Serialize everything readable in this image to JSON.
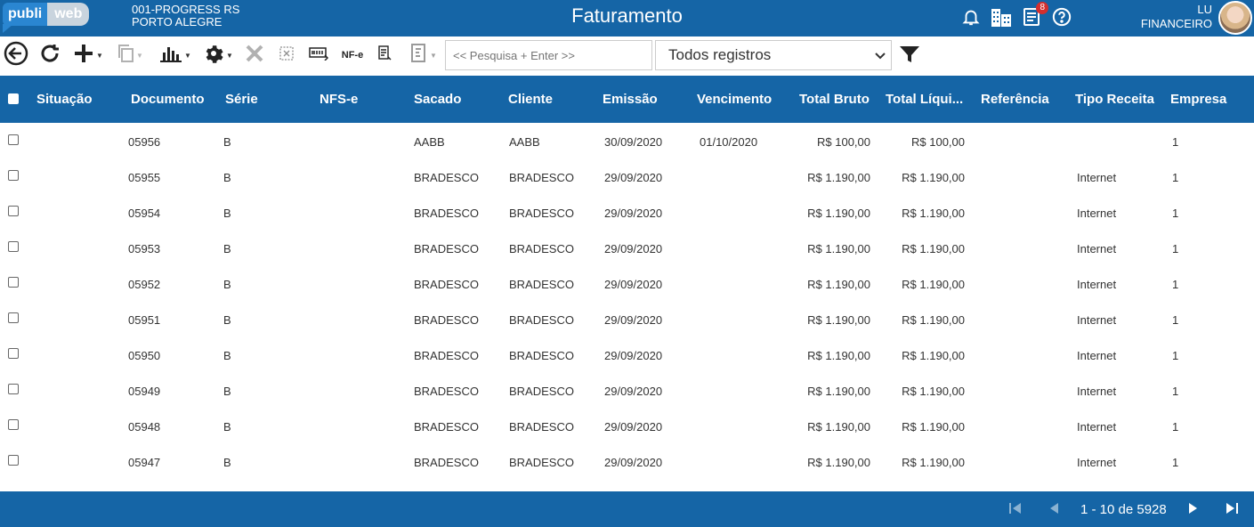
{
  "header": {
    "logo_left": "publi",
    "logo_right": "web",
    "company_line1": "001-PROGRESS RS",
    "company_line2": "PORTO ALEGRE",
    "title": "Faturamento",
    "notifications_badge": "8",
    "user_name": "LU",
    "user_role": "FINANCEIRO"
  },
  "toolbar": {
    "nfe_label": "NF-e",
    "search_placeholder": "<< Pesquisa + Enter >>",
    "filter_select_value": "Todos registros"
  },
  "table": {
    "columns": [
      "Situação",
      "Documento",
      "Série",
      "NFS-e",
      "Sacado",
      "Cliente",
      "Emissão",
      "Vencimento",
      "Total Bruto",
      "Total Líqui...",
      "Referência",
      "Tipo Receita",
      "Empresa"
    ],
    "rows": [
      {
        "situacao": "",
        "documento": "05956",
        "serie": "B",
        "nfse": "",
        "sacado": "AABB",
        "cliente": "AABB",
        "emissao": "30/09/2020",
        "vencimento": "01/10/2020",
        "total_bruto": "R$ 100,00",
        "total_liquido": "R$ 100,00",
        "referencia": "",
        "tipo_receita": "",
        "empresa": "1"
      },
      {
        "situacao": "",
        "documento": "05955",
        "serie": "B",
        "nfse": "",
        "sacado": "BRADESCO",
        "cliente": "BRADESCO",
        "emissao": "29/09/2020",
        "vencimento": "",
        "total_bruto": "R$ 1.190,00",
        "total_liquido": "R$ 1.190,00",
        "referencia": "",
        "tipo_receita": "Internet",
        "empresa": "1"
      },
      {
        "situacao": "",
        "documento": "05954",
        "serie": "B",
        "nfse": "",
        "sacado": "BRADESCO",
        "cliente": "BRADESCO",
        "emissao": "29/09/2020",
        "vencimento": "",
        "total_bruto": "R$ 1.190,00",
        "total_liquido": "R$ 1.190,00",
        "referencia": "",
        "tipo_receita": "Internet",
        "empresa": "1"
      },
      {
        "situacao": "",
        "documento": "05953",
        "serie": "B",
        "nfse": "",
        "sacado": "BRADESCO",
        "cliente": "BRADESCO",
        "emissao": "29/09/2020",
        "vencimento": "",
        "total_bruto": "R$ 1.190,00",
        "total_liquido": "R$ 1.190,00",
        "referencia": "",
        "tipo_receita": "Internet",
        "empresa": "1"
      },
      {
        "situacao": "",
        "documento": "05952",
        "serie": "B",
        "nfse": "",
        "sacado": "BRADESCO",
        "cliente": "BRADESCO",
        "emissao": "29/09/2020",
        "vencimento": "",
        "total_bruto": "R$ 1.190,00",
        "total_liquido": "R$ 1.190,00",
        "referencia": "",
        "tipo_receita": "Internet",
        "empresa": "1"
      },
      {
        "situacao": "",
        "documento": "05951",
        "serie": "B",
        "nfse": "",
        "sacado": "BRADESCO",
        "cliente": "BRADESCO",
        "emissao": "29/09/2020",
        "vencimento": "",
        "total_bruto": "R$ 1.190,00",
        "total_liquido": "R$ 1.190,00",
        "referencia": "",
        "tipo_receita": "Internet",
        "empresa": "1"
      },
      {
        "situacao": "",
        "documento": "05950",
        "serie": "B",
        "nfse": "",
        "sacado": "BRADESCO",
        "cliente": "BRADESCO",
        "emissao": "29/09/2020",
        "vencimento": "",
        "total_bruto": "R$ 1.190,00",
        "total_liquido": "R$ 1.190,00",
        "referencia": "",
        "tipo_receita": "Internet",
        "empresa": "1"
      },
      {
        "situacao": "",
        "documento": "05949",
        "serie": "B",
        "nfse": "",
        "sacado": "BRADESCO",
        "cliente": "BRADESCO",
        "emissao": "29/09/2020",
        "vencimento": "",
        "total_bruto": "R$ 1.190,00",
        "total_liquido": "R$ 1.190,00",
        "referencia": "",
        "tipo_receita": "Internet",
        "empresa": "1"
      },
      {
        "situacao": "",
        "documento": "05948",
        "serie": "B",
        "nfse": "",
        "sacado": "BRADESCO",
        "cliente": "BRADESCO",
        "emissao": "29/09/2020",
        "vencimento": "",
        "total_bruto": "R$ 1.190,00",
        "total_liquido": "R$ 1.190,00",
        "referencia": "",
        "tipo_receita": "Internet",
        "empresa": "1"
      },
      {
        "situacao": "",
        "documento": "05947",
        "serie": "B",
        "nfse": "",
        "sacado": "BRADESCO",
        "cliente": "BRADESCO",
        "emissao": "29/09/2020",
        "vencimento": "",
        "total_bruto": "R$ 1.190,00",
        "total_liquido": "R$ 1.190,00",
        "referencia": "",
        "tipo_receita": "Internet",
        "empresa": "1"
      }
    ]
  },
  "pagination": {
    "range_text": "1 - 10 de 5928"
  },
  "colors": {
    "brand_blue": "#1565a6"
  },
  "icons": [
    "back-icon",
    "refresh-icon",
    "add-icon",
    "copy-icon",
    "chart-icon",
    "gear-icon",
    "delete-icon",
    "cancel-doc-icon",
    "boleto-icon",
    "xml-icon",
    "report-icon",
    "filter-icon",
    "bell-icon",
    "buildings-icon",
    "document-icon",
    "help-icon"
  ]
}
